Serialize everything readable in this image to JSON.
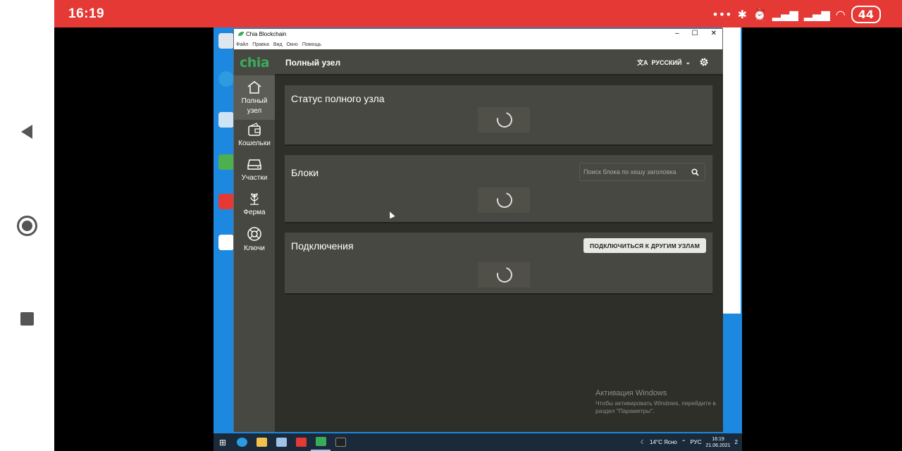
{
  "android": {
    "time": "16:19",
    "status_icons": [
      "more-icon",
      "bluetooth-icon",
      "alarm-icon",
      "signal-icon",
      "signal-icon",
      "wifi-icon"
    ],
    "battery": "44",
    "accent": "#e53935"
  },
  "window": {
    "title": "Chia Blockchain",
    "menu": [
      "Файл",
      "Правка",
      "Вид",
      "Окно",
      "Помощь"
    ]
  },
  "app": {
    "logo": "chia",
    "header_title": "Полный узел",
    "language": "РУССКИЙ",
    "accent": "#3aac59",
    "sidebar": [
      {
        "icon": "home-icon",
        "label": "Полный узел",
        "active": true
      },
      {
        "icon": "wallet-icon",
        "label": "Кошельки",
        "active": false
      },
      {
        "icon": "plots-icon",
        "label": "Участки",
        "active": false
      },
      {
        "icon": "farm-icon",
        "label": "Ферма",
        "active": false
      },
      {
        "icon": "keys-icon",
        "label": "Ключи",
        "active": false
      }
    ],
    "cards": {
      "status": {
        "title": "Статус полного узла"
      },
      "blocks": {
        "title": "Блоки",
        "search_placeholder": "Поиск блока по хешу заголовка"
      },
      "connections": {
        "title": "Подключения",
        "button": "ПОДКЛЮЧИТЬСЯ К ДРУГИМ УЗЛАМ"
      }
    }
  },
  "taskbar": {
    "weather": "14°C Ясно",
    "lang": "РУС",
    "time": "16:19",
    "date": "21.06.2021",
    "notifications": "2"
  },
  "activation": {
    "title": "Активация Windows",
    "text": "Чтобы активировать Windows, перейдите в раздел \"Параметры\"."
  }
}
